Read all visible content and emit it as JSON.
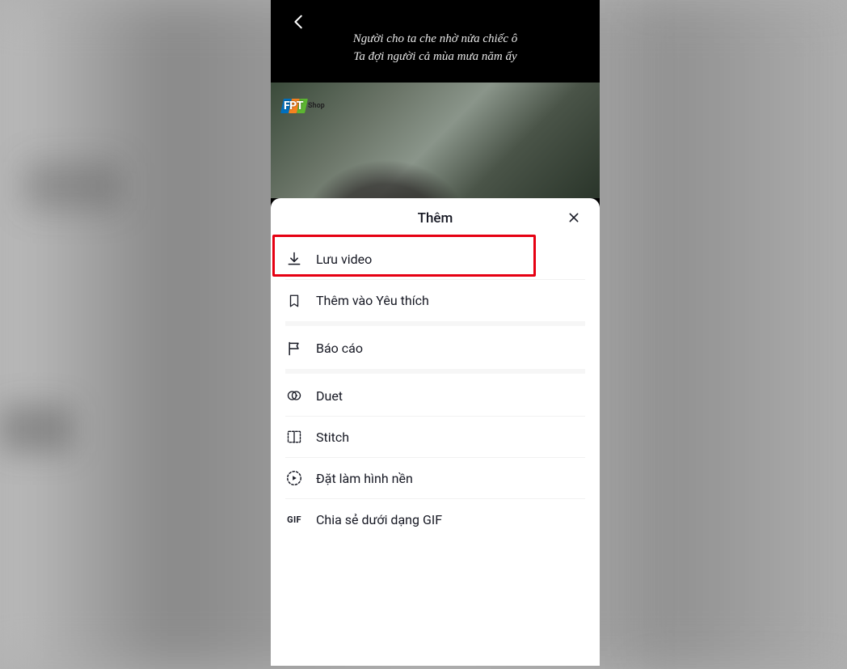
{
  "header": {
    "lyric_line_1": "Người cho ta che nhờ nửa chiếc ô",
    "lyric_line_2": "Ta đợi người cả mùa mưa năm ấy"
  },
  "watermark": {
    "brand": "FPT",
    "sub": "Shop"
  },
  "sheet": {
    "title": "Thêm"
  },
  "menu": {
    "save_video": "Lưu video",
    "add_favorite": "Thêm vào Yêu thích",
    "report": "Báo cáo",
    "duet": "Duet",
    "stitch": "Stitch",
    "set_wallpaper": "Đặt làm hình nền",
    "share_gif": "Chia sẻ dưới dạng GIF",
    "gif_icon_label": "GIF"
  },
  "highlight": {
    "target": "save_video"
  }
}
